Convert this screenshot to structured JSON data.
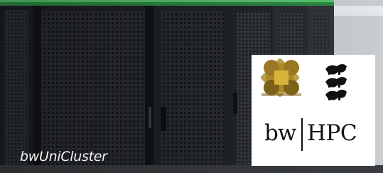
{
  "caption": "bwUniCluster",
  "logo": {
    "left_text": "bw",
    "right_text": "HPC"
  },
  "colors": {
    "logo_gold": "#a8852a",
    "logo_gold_light": "#d7b23d",
    "rack_dark": "#23262a",
    "floor": "#cfd3d6",
    "top_strip": "#3fa85a"
  }
}
